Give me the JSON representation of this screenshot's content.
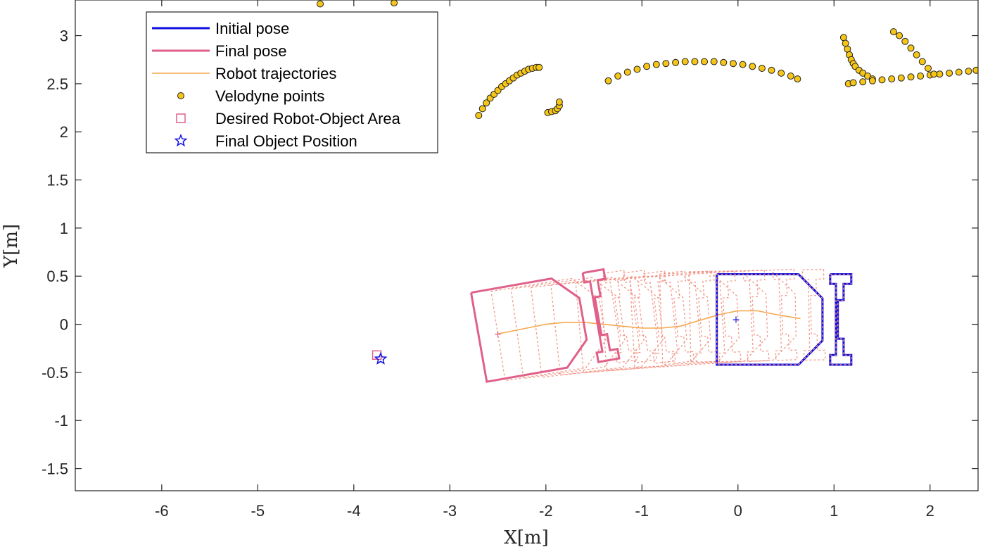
{
  "chart_data": {
    "type": "scatter",
    "xlabel": "X[m]",
    "ylabel": "Y[m]",
    "xlim": [
      -6.9,
      2.5
    ],
    "ylim": [
      -1.73,
      3.37
    ],
    "xticks": [
      -6,
      -5,
      -4,
      -3,
      -2,
      -1,
      0,
      1,
      2
    ],
    "yticks": [
      -1.5,
      -1,
      -0.5,
      0,
      0.5,
      1,
      1.5,
      2,
      2.5,
      3
    ],
    "xtick_labels": [
      "-6",
      "-5",
      "-4",
      "-3",
      "-2",
      "-1",
      "0",
      "1",
      "2"
    ],
    "ytick_labels": [
      "-1.5",
      "-1",
      "-0.5",
      "0",
      "0.5",
      "1",
      "1.5",
      "2",
      "2.5",
      "3"
    ],
    "grid": false,
    "box": true,
    "legend_position": "top-left",
    "colors": {
      "initial_pose": "#1010e0",
      "final_pose": "#e0608a",
      "intermediate_pose": "#f08878",
      "trajectory": "#f5a84f",
      "velodyne_fill": "#f5c518",
      "velodyne_edge": "#202020",
      "desired_area": "#e0608a",
      "final_object": "#1010e0"
    },
    "legend": [
      {
        "label": "Initial pose",
        "key": "initial_pose",
        "marker": "line-thick"
      },
      {
        "label": "Final pose",
        "key": "final_pose",
        "marker": "line-thick"
      },
      {
        "label": "Robot trajectories",
        "key": "trajectory",
        "marker": "line-thin"
      },
      {
        "label": "Velodyne points",
        "key": "velodyne",
        "marker": "circle"
      },
      {
        "label": "Desired Robot-Object Area",
        "key": "desired_area",
        "marker": "square"
      },
      {
        "label": "Final Object Position",
        "key": "final_object",
        "marker": "star"
      }
    ],
    "robot_footprint_local": [
      [
        -0.2,
        0.47
      ],
      [
        0.65,
        0.47
      ],
      [
        0.9,
        0.22
      ],
      [
        0.9,
        -0.22
      ],
      [
        0.65,
        -0.47
      ],
      [
        -0.2,
        -0.47
      ],
      [
        -0.2,
        0.47
      ]
    ],
    "robot_head_local": [
      [
        0.98,
        0.47
      ],
      [
        1.2,
        0.47
      ],
      [
        1.2,
        0.37
      ],
      [
        1.12,
        0.37
      ],
      [
        1.12,
        0.2
      ],
      [
        1.06,
        0.2
      ],
      [
        1.06,
        -0.2
      ],
      [
        1.12,
        -0.2
      ],
      [
        1.12,
        -0.37
      ],
      [
        1.2,
        -0.37
      ],
      [
        1.2,
        -0.47
      ],
      [
        0.98,
        -0.47
      ],
      [
        0.98,
        -0.37
      ],
      [
        1.04,
        -0.37
      ],
      [
        1.04,
        0.37
      ],
      [
        0.98,
        0.37
      ],
      [
        0.98,
        0.47
      ]
    ],
    "initial_pose": {
      "x": -0.02,
      "y": 0.05,
      "theta_deg": 0
    },
    "final_pose": {
      "x": -2.5,
      "y": -0.1,
      "theta_deg": 10
    },
    "intermediate_poses": [
      {
        "x": -0.3,
        "y": 0.08,
        "theta_deg": 1
      },
      {
        "x": -0.6,
        "y": 0.06,
        "theta_deg": 2
      },
      {
        "x": -0.9,
        "y": 0.03,
        "theta_deg": 3
      },
      {
        "x": -1.2,
        "y": 0.0,
        "theta_deg": 4
      },
      {
        "x": -1.45,
        "y": -0.02,
        "theta_deg": 5
      },
      {
        "x": -1.7,
        "y": -0.04,
        "theta_deg": 6
      },
      {
        "x": -1.9,
        "y": -0.06,
        "theta_deg": 7
      },
      {
        "x": -2.1,
        "y": -0.07,
        "theta_deg": 8
      },
      {
        "x": -2.3,
        "y": -0.09,
        "theta_deg": 9
      }
    ],
    "trajectory": {
      "x": [
        0.65,
        0.4,
        0.2,
        0.0,
        -0.2,
        -0.4,
        -0.6,
        -0.8,
        -1.0,
        -1.2,
        -1.4,
        -1.6,
        -1.8,
        -2.0,
        -2.2,
        -2.4,
        -2.5
      ],
      "y": [
        0.06,
        0.1,
        0.14,
        0.14,
        0.1,
        0.04,
        -0.02,
        -0.04,
        -0.04,
        -0.02,
        0.0,
        0.02,
        0.02,
        0.0,
        -0.04,
        -0.08,
        -0.1
      ]
    },
    "velodyne_points": {
      "x": [
        -4.35,
        -3.58,
        -2.7,
        -2.66,
        -2.62,
        -2.58,
        -2.54,
        -2.5,
        -2.46,
        -2.42,
        -2.38,
        -2.34,
        -2.3,
        -2.26,
        -2.22,
        -2.18,
        -2.14,
        -2.1,
        -2.07,
        -1.98,
        -1.94,
        -1.9,
        -1.88,
        -1.86,
        -1.86,
        -1.35,
        -1.25,
        -1.15,
        -1.05,
        -0.95,
        -0.85,
        -0.75,
        -0.65,
        -0.55,
        -0.45,
        -0.35,
        -0.25,
        -0.15,
        -0.05,
        0.05,
        0.15,
        0.25,
        0.35,
        0.45,
        0.55,
        0.62,
        1.1,
        1.12,
        1.14,
        1.16,
        1.18,
        1.2,
        1.22,
        1.26,
        1.3,
        1.35,
        1.4,
        1.15,
        1.2,
        1.3,
        1.4,
        1.5,
        1.6,
        1.7,
        1.8,
        1.9,
        2.0,
        2.1,
        2.2,
        2.3,
        2.4,
        2.48,
        1.62,
        1.68,
        1.74,
        1.8,
        1.86,
        1.92,
        1.98,
        2.04
      ],
      "y": [
        3.33,
        3.34,
        2.17,
        2.24,
        2.3,
        2.35,
        2.39,
        2.43,
        2.47,
        2.5,
        2.53,
        2.56,
        2.59,
        2.61,
        2.63,
        2.65,
        2.66,
        2.67,
        2.67,
        2.2,
        2.21,
        2.22,
        2.24,
        2.27,
        2.31,
        2.53,
        2.58,
        2.62,
        2.65,
        2.68,
        2.7,
        2.71,
        2.72,
        2.73,
        2.73,
        2.73,
        2.73,
        2.72,
        2.71,
        2.7,
        2.68,
        2.66,
        2.64,
        2.61,
        2.58,
        2.55,
        2.98,
        2.92,
        2.86,
        2.8,
        2.75,
        2.71,
        2.68,
        2.64,
        2.61,
        2.58,
        2.55,
        2.5,
        2.51,
        2.52,
        2.53,
        2.54,
        2.55,
        2.56,
        2.57,
        2.58,
        2.59,
        2.6,
        2.61,
        2.62,
        2.63,
        2.64,
        3.04,
        3.0,
        2.94,
        2.87,
        2.8,
        2.73,
        2.66,
        2.6
      ]
    },
    "desired_area": {
      "x": -3.76,
      "y": -0.32
    },
    "final_object": {
      "x": -3.72,
      "y": -0.36
    }
  }
}
